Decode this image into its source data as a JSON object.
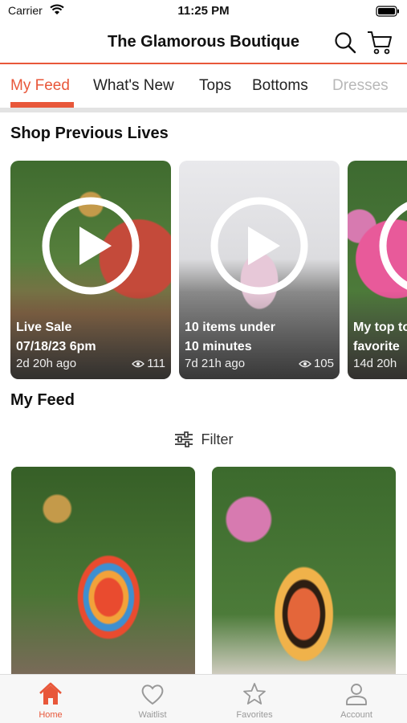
{
  "status_bar": {
    "carrier": "Carrier",
    "time": "11:25 PM"
  },
  "header": {
    "title": "The Glamorous Boutique"
  },
  "tabs": [
    {
      "label": "My Feed",
      "active": true
    },
    {
      "label": "What's New"
    },
    {
      "label": "Tops"
    },
    {
      "label": "Bottoms"
    },
    {
      "label": "Dresses"
    }
  ],
  "previous_lives": {
    "title": "Shop Previous Lives",
    "cards": [
      {
        "title_line1": "Live Sale",
        "title_line2": "07/18/23 6pm",
        "age": "2d 20h ago",
        "views": "111"
      },
      {
        "title_line1": "10 items under",
        "title_line2": "10 minutes",
        "age": "7d 21h ago",
        "views": "105"
      },
      {
        "title_line1": "My top to",
        "title_line2": "favorite",
        "age": "14d 20h",
        "views": ""
      }
    ]
  },
  "feed": {
    "title": "My Feed",
    "filter_label": "Filter"
  },
  "bottom_nav": [
    {
      "label": "Home",
      "active": true
    },
    {
      "label": "Waitlist"
    },
    {
      "label": "Favorites"
    },
    {
      "label": "Account"
    }
  ],
  "colors": {
    "accent": "#e8573a",
    "inactive": "#999999"
  }
}
